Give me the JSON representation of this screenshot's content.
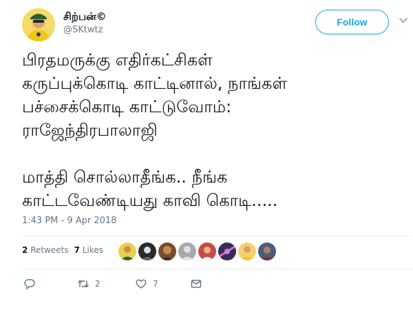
{
  "user": {
    "name": "சிற்பன்©",
    "handle": "@SKtwtz",
    "follow_label": "Follow"
  },
  "tweet": {
    "text": "பிரதமருக்கு எதிர்கட்சிகள்\nகருப்புக்கொடி காட்டினால், நாங்கள்\nபச்சைக்கொடி காட்டுவோம்:\nராஜேந்திரபாலாஜி\n\nமாத்தி சொல்லாதீங்க.. நீங்க\nகாட்டவேண்டியது காவி கொடி.....",
    "timestamp": "1:43 PM - 9 Apr 2018"
  },
  "stats": {
    "retweets_count": "2",
    "retweets_label": "Retweets",
    "likes_count": "7",
    "likes_label": "Likes"
  },
  "actions": {
    "retweet_count": "2",
    "like_count": "7"
  },
  "icons": {
    "reply": "reply-icon",
    "retweet": "retweet-icon",
    "like": "heart-icon",
    "message": "envelope-icon",
    "caret": "chevron-down-icon"
  },
  "colors": {
    "accent": "#1da1f2",
    "muted": "#657786",
    "text": "#14171a",
    "divider": "#e6ecf0"
  }
}
